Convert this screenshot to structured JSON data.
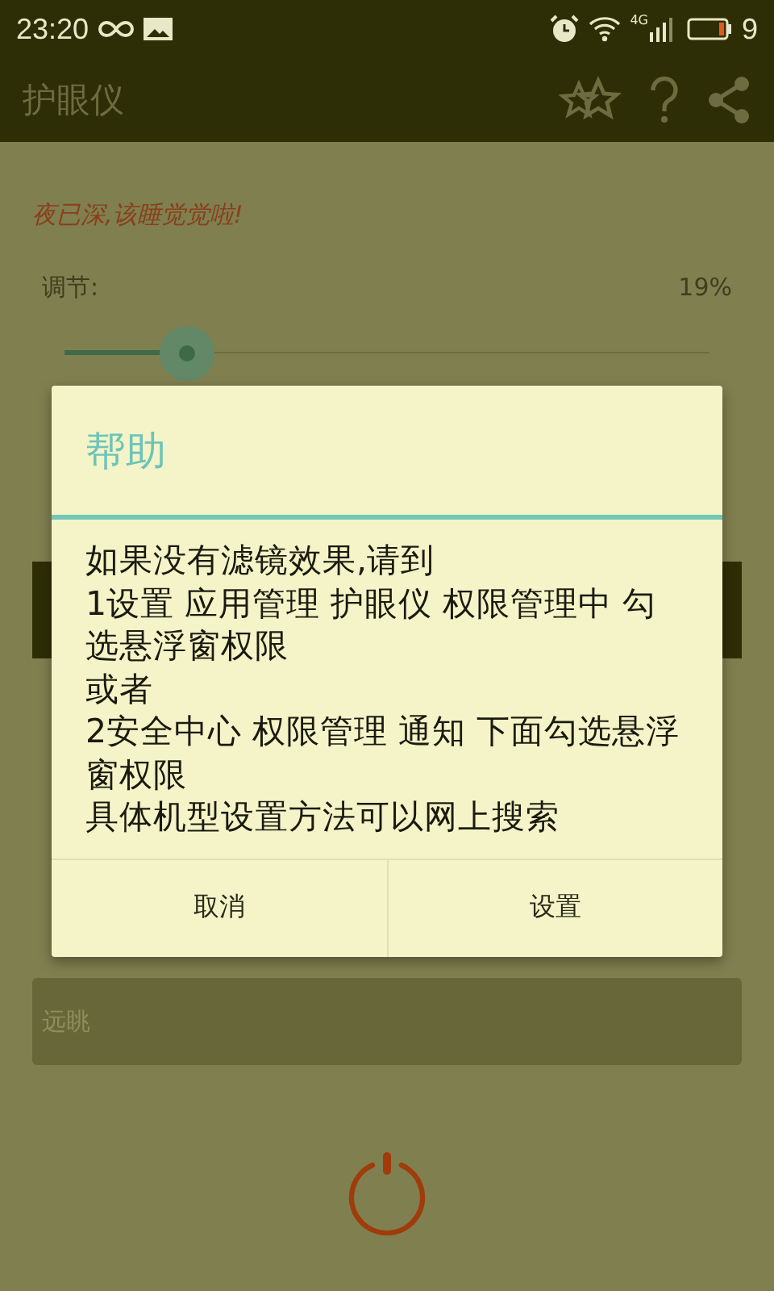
{
  "status_bar": {
    "time": "23:20",
    "network": "4G",
    "battery": "9"
  },
  "app_bar": {
    "title": "护眼仪"
  },
  "content": {
    "notice": "夜已深,该睡觉觉啦!",
    "adjust_label": "调节:",
    "adjust_value": "19%",
    "slider": {
      "level": 0.19
    },
    "option": "远眺"
  },
  "dialog": {
    "title": "帮助",
    "message": [
      "如果没有滤镜效果,请到",
      "1设置 应用管理 护眼仪 权限管理中 勾选悬浮窗权限",
      "或者",
      "2安全中心 权限管理 通知 下面勾选悬浮窗权限",
      "具体机型设置方法可以网上搜索"
    ],
    "buttons": [
      "取消",
      "设置"
    ]
  }
}
